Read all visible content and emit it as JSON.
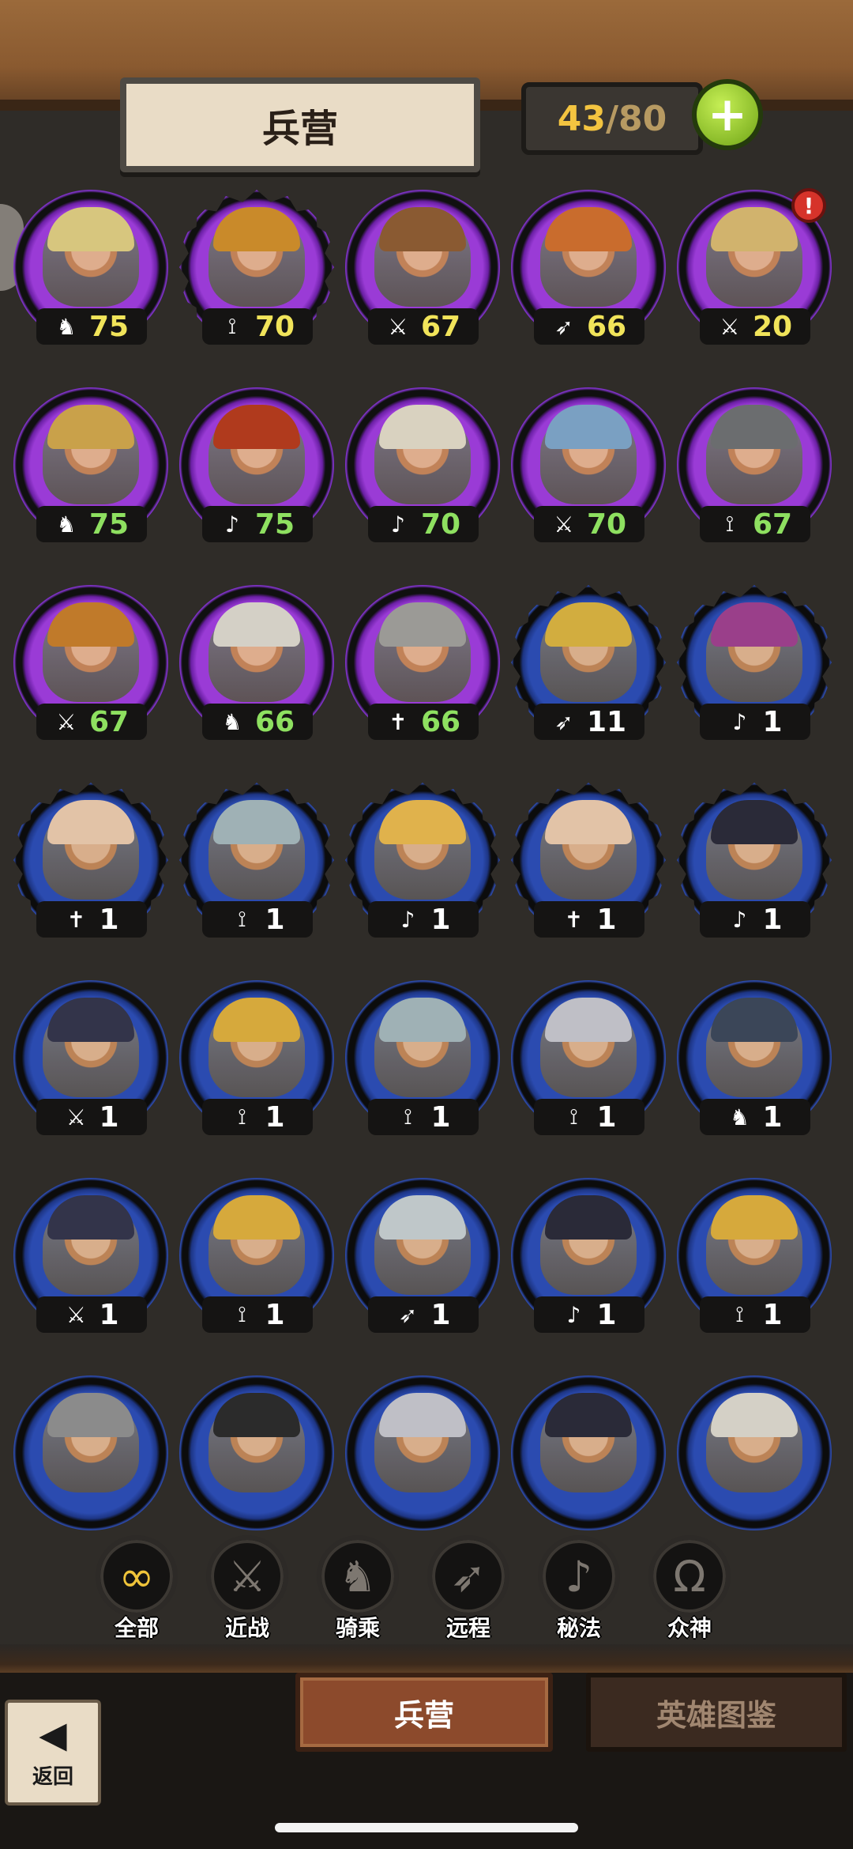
{
  "header": {
    "title": "兵营",
    "count_current": "43",
    "count_separator": "/",
    "count_max": "80",
    "plus_label": "+"
  },
  "units": [
    {
      "frame": "purple",
      "shape": "round",
      "cls": "♞",
      "level": "75",
      "level_color": "yellow",
      "helm": "#d7c67e"
    },
    {
      "frame": "purple",
      "shape": "star",
      "cls": "⟟",
      "level": "70",
      "level_color": "yellow",
      "helm": "#c98a2a"
    },
    {
      "frame": "purple",
      "shape": "round",
      "cls": "⚔",
      "level": "67",
      "level_color": "yellow",
      "helm": "#8a5a32"
    },
    {
      "frame": "purple",
      "shape": "round",
      "cls": "➶",
      "level": "66",
      "level_color": "yellow",
      "helm": "#c96c2d"
    },
    {
      "frame": "purple",
      "shape": "round",
      "cls": "⚔",
      "level": "20",
      "level_color": "yellow",
      "helm": "#d1b36d",
      "alert": "!"
    },
    {
      "frame": "purple",
      "shape": "round",
      "cls": "♞",
      "level": "75",
      "level_color": "green",
      "helm": "#c9a14a"
    },
    {
      "frame": "purple",
      "shape": "round",
      "cls": "♪",
      "level": "75",
      "level_color": "green",
      "helm": "#b03a1d"
    },
    {
      "frame": "purple",
      "shape": "round",
      "cls": "♪",
      "level": "70",
      "level_color": "green",
      "helm": "#d9d2c0"
    },
    {
      "frame": "purple",
      "shape": "round",
      "cls": "⚔",
      "level": "70",
      "level_color": "green",
      "helm": "#7aa0c2"
    },
    {
      "frame": "purple",
      "shape": "round",
      "cls": "⟟",
      "level": "67",
      "level_color": "green",
      "helm": "#6b6d6f"
    },
    {
      "frame": "purple",
      "shape": "round",
      "cls": "⚔",
      "level": "67",
      "level_color": "green",
      "helm": "#c07a2a"
    },
    {
      "frame": "purple",
      "shape": "round",
      "cls": "♞",
      "level": "66",
      "level_color": "green",
      "helm": "#d4d0c6"
    },
    {
      "frame": "purple",
      "shape": "round",
      "cls": "✝",
      "level": "66",
      "level_color": "green",
      "helm": "#9b9a96"
    },
    {
      "frame": "blue",
      "shape": "star",
      "cls": "➶",
      "level": "11",
      "level_color": "white",
      "helm": "#d2ad3f"
    },
    {
      "frame": "blue",
      "shape": "star",
      "cls": "♪",
      "level": "1",
      "level_color": "white",
      "helm": "#9a3f8a"
    },
    {
      "frame": "blue",
      "shape": "star",
      "cls": "✝",
      "level": "1",
      "level_color": "white",
      "helm": "#e2c3a7"
    },
    {
      "frame": "blue",
      "shape": "star",
      "cls": "⟟",
      "level": "1",
      "level_color": "white",
      "helm": "#9fb1b5"
    },
    {
      "frame": "blue",
      "shape": "star",
      "cls": "♪",
      "level": "1",
      "level_color": "white",
      "helm": "#e0b24c"
    },
    {
      "frame": "blue",
      "shape": "star",
      "cls": "✝",
      "level": "1",
      "level_color": "white",
      "helm": "#e2c3a7"
    },
    {
      "frame": "blue",
      "shape": "star",
      "cls": "♪",
      "level": "1",
      "level_color": "white",
      "helm": "#2a2a38"
    },
    {
      "frame": "blue",
      "shape": "round",
      "cls": "⚔",
      "level": "1",
      "level_color": "white",
      "helm": "#33344a"
    },
    {
      "frame": "blue",
      "shape": "round",
      "cls": "⟟",
      "level": "1",
      "level_color": "white",
      "helm": "#d6a93c"
    },
    {
      "frame": "blue",
      "shape": "round",
      "cls": "⟟",
      "level": "1",
      "level_color": "white",
      "helm": "#9fb1b5"
    },
    {
      "frame": "blue",
      "shape": "round",
      "cls": "⟟",
      "level": "1",
      "level_color": "white",
      "helm": "#bfbfc6"
    },
    {
      "frame": "blue",
      "shape": "round",
      "cls": "♞",
      "level": "1",
      "level_color": "white",
      "helm": "#3b4658"
    },
    {
      "frame": "blue",
      "shape": "round",
      "cls": "⚔",
      "level": "1",
      "level_color": "white",
      "helm": "#33344a"
    },
    {
      "frame": "blue",
      "shape": "round",
      "cls": "⟟",
      "level": "1",
      "level_color": "white",
      "helm": "#d6a93c"
    },
    {
      "frame": "blue",
      "shape": "round",
      "cls": "➶",
      "level": "1",
      "level_color": "white",
      "helm": "#bfc7c9"
    },
    {
      "frame": "blue",
      "shape": "round",
      "cls": "♪",
      "level": "1",
      "level_color": "white",
      "helm": "#2a2a38"
    },
    {
      "frame": "blue",
      "shape": "round",
      "cls": "⟟",
      "level": "1",
      "level_color": "white",
      "helm": "#d6a93c"
    },
    {
      "frame": "blue",
      "shape": "round",
      "cls": "",
      "level": "",
      "level_color": "white",
      "helm": "#8b8b8b"
    },
    {
      "frame": "blue",
      "shape": "round",
      "cls": "",
      "level": "",
      "level_color": "white",
      "helm": "#2b2b2b"
    },
    {
      "frame": "blue",
      "shape": "round",
      "cls": "",
      "level": "",
      "level_color": "white",
      "helm": "#bfbfc6"
    },
    {
      "frame": "blue",
      "shape": "round",
      "cls": "",
      "level": "",
      "level_color": "white",
      "helm": "#2a2a38"
    },
    {
      "frame": "blue",
      "shape": "round",
      "cls": "",
      "level": "",
      "level_color": "white",
      "helm": "#d4d0c6"
    }
  ],
  "filters": [
    {
      "label": "全部",
      "icon": "∞",
      "icon_name": "infinity-icon",
      "active": true
    },
    {
      "label": "近战",
      "icon": "⚔",
      "icon_name": "sword-icon",
      "active": false
    },
    {
      "label": "骑乘",
      "icon": "♞",
      "icon_name": "horse-icon",
      "active": false
    },
    {
      "label": "远程",
      "icon": "➶",
      "icon_name": "bow-icon",
      "active": false
    },
    {
      "label": "秘法",
      "icon": "♪",
      "icon_name": "arcane-icon",
      "active": false
    },
    {
      "label": "众神",
      "icon": "Ω",
      "icon_name": "omega-icon",
      "active": false
    }
  ],
  "bottom_tabs": {
    "barracks": "兵营",
    "hero_codex": "英雄图鉴"
  },
  "back": {
    "label": "返回",
    "icon": "◀"
  },
  "colors": {
    "level_yellow": "#f1e45a",
    "level_green": "#8ee060",
    "frame_purple": "#9a3bd6",
    "frame_blue": "#2b4bb0",
    "accent_gold": "#f3c440"
  }
}
